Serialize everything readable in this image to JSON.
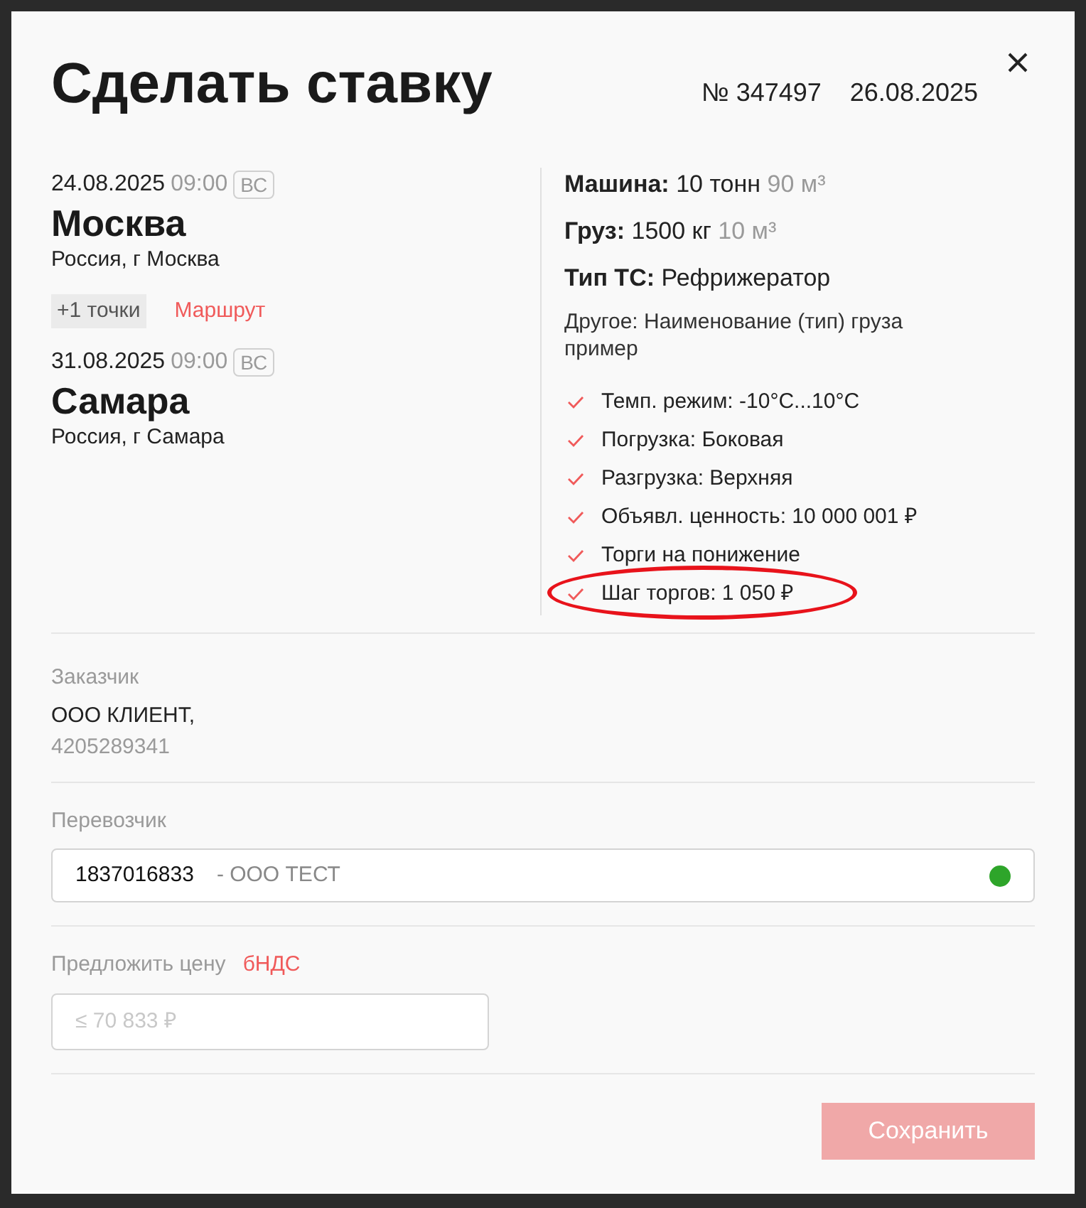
{
  "dialog": {
    "title": "Сделать ставку",
    "number": "№ 347497",
    "date": "26.08.2025"
  },
  "route": {
    "stops": [
      {
        "date": "24.08.2025",
        "time": "09:00",
        "weekday": "ВС",
        "city": "Москва",
        "address": "Россия, г Москва"
      },
      {
        "date": "31.08.2025",
        "time": "09:00",
        "weekday": "ВС",
        "city": "Самара",
        "address": "Россия, г Самара"
      }
    ],
    "extra_points": "+1 точки",
    "route_link": "Маршрут"
  },
  "specs": [
    {
      "label": "Машина:",
      "value": "10 тонн",
      "extra": "90 м³"
    },
    {
      "label": "Груз:",
      "value": "1500 кг",
      "extra": "10 м³"
    },
    {
      "label": "Тип ТС:",
      "value": "Рефрижератор"
    }
  ],
  "other_note": "Другое: Наименование (тип) груза пример",
  "conditions": [
    {
      "text": "Темп. режим: -10°C...10°C",
      "highlighted": false
    },
    {
      "text": "Погрузка: Боковая",
      "highlighted": false
    },
    {
      "text": "Разгрузка: Верхняя",
      "highlighted": false
    },
    {
      "text": "Объявл. ценность: 10 000 001 ₽",
      "highlighted": false
    },
    {
      "text": "Торги на понижение",
      "highlighted": false
    },
    {
      "text": "Шаг торгов: 1 050 ₽",
      "highlighted": true
    }
  ],
  "customer": {
    "label": "Заказчик",
    "name": "ООО КЛИЕНТ,",
    "inn": "4205289341"
  },
  "carrier": {
    "label": "Перевозчик",
    "inn": "1837016833",
    "name": "- ООО ТЕСТ",
    "online": true
  },
  "price": {
    "label": "Предложить цену",
    "tax": "бНДС",
    "placeholder": "≤ 70 833 ₽"
  },
  "save_button": {
    "label": "Сохранить",
    "disabled": true
  }
}
